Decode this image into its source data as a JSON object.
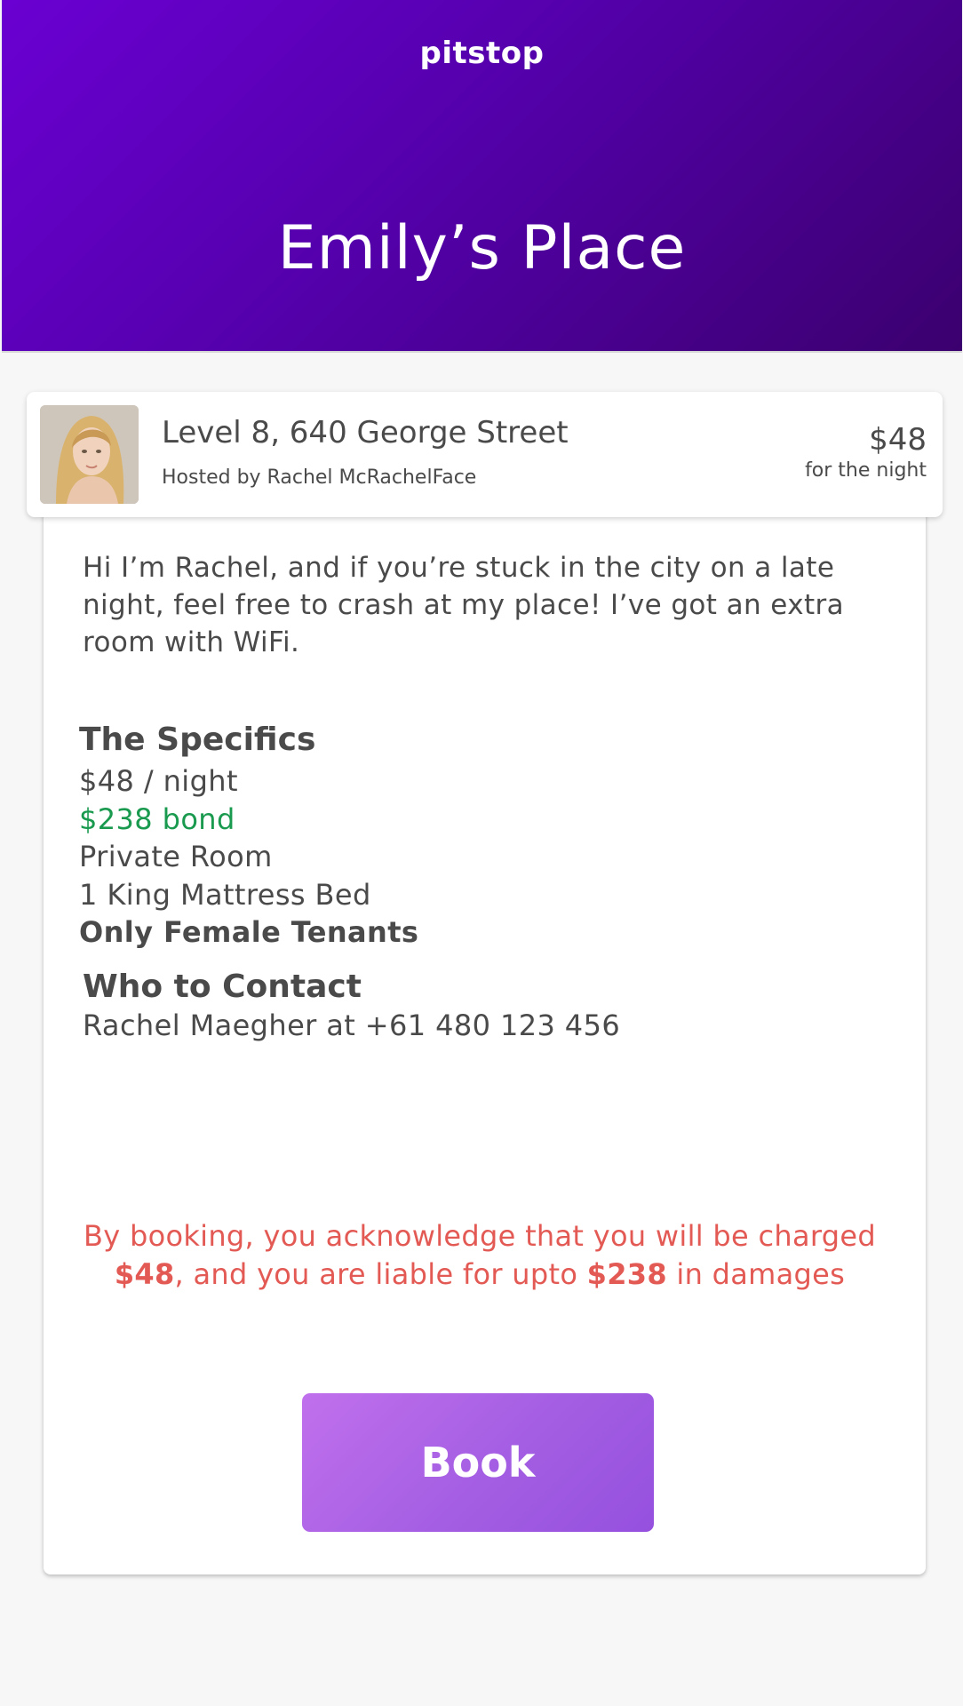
{
  "header": {
    "brand": "pitstop",
    "title": "Emily’s Place"
  },
  "listing": {
    "address": "Level 8, 640 George Street",
    "host": "Hosted by Rachel McRachelFace",
    "price": "$48",
    "price_period": "for the night"
  },
  "description": "Hi I’m Rachel, and if you’re stuck in the city on a late night, feel free to crash at my place! I’ve got an extra room with WiFi.",
  "specifics": {
    "heading": "The Specifics",
    "nightly": "$48 / night",
    "bond": "$238 bond",
    "room_type": "Private Room",
    "bed": "1 King Mattress Bed",
    "restriction": "Only Female Tenants"
  },
  "contact": {
    "heading": "Who to Contact",
    "line": "Rachel Maegher at +61 480 123 456"
  },
  "disclaimer": {
    "part1": "By booking, you acknowledge that you will be charged ",
    "charge": "$48",
    "part2": ", and you are liable for upto ",
    "liability": "$238",
    "part3": " in damages"
  },
  "book_button_label": "Book",
  "colors": {
    "header_gradient_start": "#6a00d2",
    "header_gradient_end": "#3b006e",
    "bond_green": "#1a9a4f",
    "disclaimer_red": "#e35a55",
    "button_gradient_start": "#c070ec",
    "button_gradient_end": "#9550de"
  }
}
